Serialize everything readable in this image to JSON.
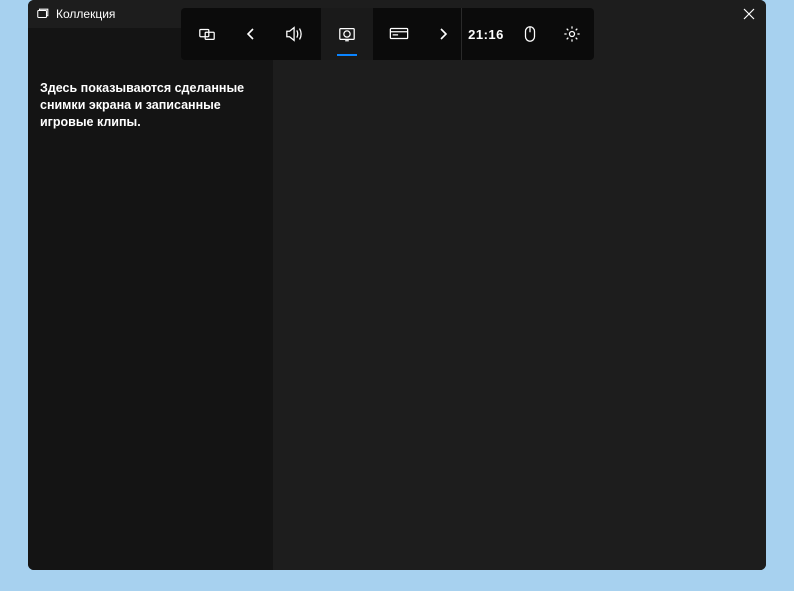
{
  "window": {
    "title": "Коллекция"
  },
  "sidebar": {
    "message": "Здесь показываются сделанные снимки экрана и записанные игровые клипы."
  },
  "toolbar": {
    "time": "21:16"
  }
}
